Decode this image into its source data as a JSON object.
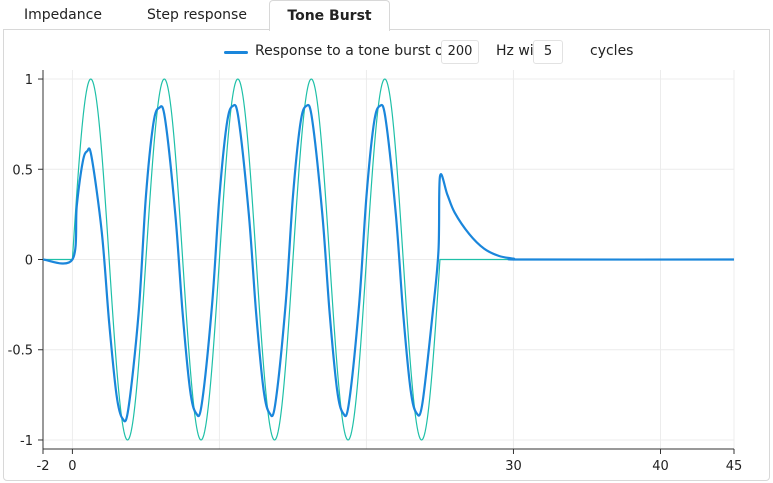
{
  "tabs": [
    {
      "label": "Impedance",
      "active": false
    },
    {
      "label": "Step response",
      "active": false
    },
    {
      "label": "Tone Burst",
      "active": true
    }
  ],
  "legend": {
    "text_before": "Response to a tone burst of",
    "frequency_value": "200",
    "text_middle": "Hz wi",
    "cycles_value": "5",
    "text_after": "cycles"
  },
  "colors": {
    "response": "#1a86db",
    "input": "#1fc0a8",
    "grid": "#ececec"
  },
  "chart_data": {
    "type": "line",
    "xlim": [
      -2,
      45
    ],
    "ylim": [
      -1.05,
      1.05
    ],
    "x_ticks": [
      -2,
      0,
      30,
      40,
      45
    ],
    "y_ticks": [
      1,
      0.5,
      0,
      -0.5,
      -1
    ],
    "grid": true,
    "legend_position": "top",
    "series": [
      {
        "name": "Response to a tone burst",
        "role": "response",
        "points": [
          [
            -2,
            0
          ],
          [
            0,
            0
          ],
          [
            0.3,
            0.3
          ],
          [
            0.7,
            0.54
          ],
          [
            1,
            0.6
          ],
          [
            1.3,
            0.57
          ],
          [
            2,
            0.15
          ],
          [
            2.5,
            -0.35
          ],
          [
            3,
            -0.75
          ],
          [
            3.4,
            -0.88
          ],
          [
            3.8,
            -0.83
          ],
          [
            4.5,
            -0.3
          ],
          [
            5,
            0.35
          ],
          [
            5.5,
            0.75
          ],
          [
            5.9,
            0.84
          ],
          [
            6.3,
            0.78
          ],
          [
            7,
            0.25
          ],
          [
            7.5,
            -0.3
          ],
          [
            8,
            -0.72
          ],
          [
            8.4,
            -0.85
          ],
          [
            8.8,
            -0.8
          ],
          [
            9.5,
            -0.25
          ],
          [
            10,
            0.35
          ],
          [
            10.5,
            0.75
          ],
          [
            10.9,
            0.85
          ],
          [
            11.3,
            0.78
          ],
          [
            12,
            0.25
          ],
          [
            12.5,
            -0.3
          ],
          [
            13,
            -0.72
          ],
          [
            13.4,
            -0.85
          ],
          [
            13.8,
            -0.8
          ],
          [
            14.5,
            -0.25
          ],
          [
            15,
            0.35
          ],
          [
            15.5,
            0.75
          ],
          [
            15.9,
            0.85
          ],
          [
            16.3,
            0.78
          ],
          [
            17,
            0.25
          ],
          [
            17.5,
            -0.3
          ],
          [
            18,
            -0.72
          ],
          [
            18.4,
            -0.85
          ],
          [
            18.8,
            -0.8
          ],
          [
            19.5,
            -0.25
          ],
          [
            20,
            0.35
          ],
          [
            20.5,
            0.75
          ],
          [
            20.9,
            0.85
          ],
          [
            21.3,
            0.78
          ],
          [
            22,
            0.25
          ],
          [
            22.5,
            -0.3
          ],
          [
            23,
            -0.72
          ],
          [
            23.4,
            -0.85
          ],
          [
            23.8,
            -0.8
          ],
          [
            24.5,
            -0.3
          ],
          [
            24.9,
            0.05
          ],
          [
            25,
            0.46
          ],
          [
            25.5,
            0.36
          ],
          [
            26,
            0.26
          ],
          [
            27,
            0.14
          ],
          [
            28,
            0.06
          ],
          [
            29,
            0.02
          ],
          [
            30,
            0.005
          ],
          [
            31,
            0
          ],
          [
            45,
            0
          ]
        ]
      },
      {
        "name": "Tone burst",
        "role": "input",
        "function": "sin",
        "amplitude": 1,
        "period": 5,
        "cycles": 5,
        "start": 0
      }
    ]
  }
}
